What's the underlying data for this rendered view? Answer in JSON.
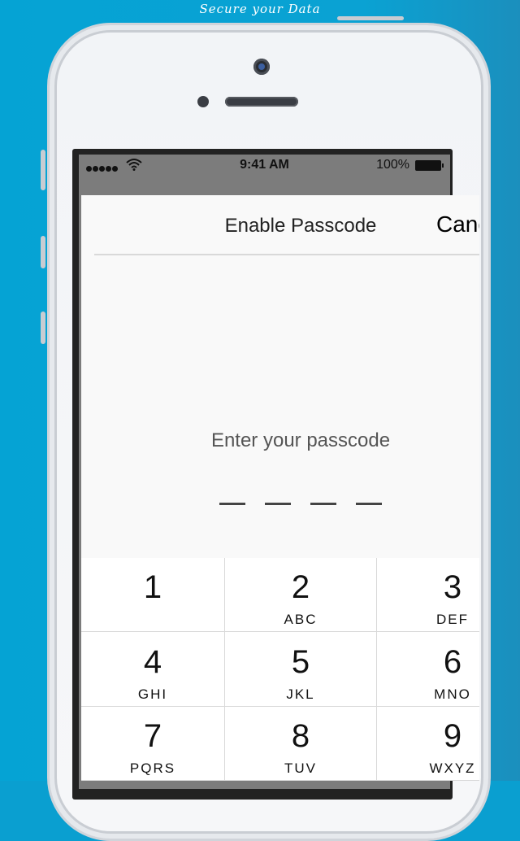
{
  "promo": {
    "title": "Secure your Data"
  },
  "statusbar": {
    "time": "9:41 AM",
    "battery": "100%"
  },
  "nav": {
    "title": "Enable Passcode",
    "cancel_label": "Canc"
  },
  "passcode": {
    "prompt": "Enter your passcode",
    "digits_entered": 0,
    "length": 4
  },
  "keypad": [
    {
      "num": "1",
      "letters": ""
    },
    {
      "num": "2",
      "letters": "ABC"
    },
    {
      "num": "3",
      "letters": "DEF"
    },
    {
      "num": "4",
      "letters": "GHI"
    },
    {
      "num": "5",
      "letters": "JKL"
    },
    {
      "num": "6",
      "letters": "MNO"
    },
    {
      "num": "7",
      "letters": "PQRS"
    },
    {
      "num": "8",
      "letters": "TUV"
    },
    {
      "num": "9",
      "letters": "WXYZ"
    }
  ],
  "colors": {
    "background": "#0aa2d3",
    "sheet": "#f9f9f9",
    "keypad": "#ffffff"
  }
}
